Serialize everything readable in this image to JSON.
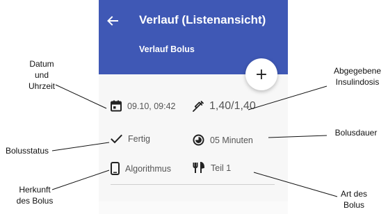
{
  "app_bar": {
    "title": "Verlauf (Listenansicht)",
    "subtitle": "Verlauf Bolus",
    "color": "#3f58b5"
  },
  "fab": {
    "icon": "plus-icon",
    "label": "+"
  },
  "entry": {
    "datetime": "09.10, 09:42",
    "dose": "1,40/1,40",
    "status": "Fertig",
    "duration": "05 Minuten",
    "origin": "Algorithmus",
    "type": "Teil 1"
  },
  "annotations": {
    "datetime_l1": "Datum",
    "datetime_l2": "und",
    "datetime_l3": "Uhrzeit",
    "dose_l1": "Abgegebene",
    "dose_l2": "Insulindosis",
    "status": "Bolusstatus",
    "duration": "Bolusdauer",
    "origin_l1": "Herkunft",
    "origin_l2": "des Bolus",
    "type_l1": "Art des",
    "type_l2": "Bolus"
  }
}
